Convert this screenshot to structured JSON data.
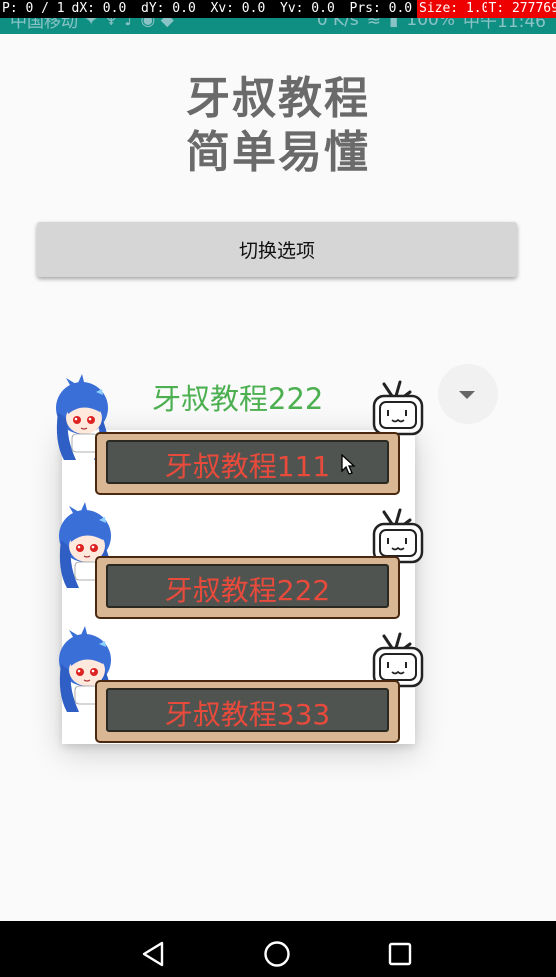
{
  "status_bar": {
    "carrier": "中国移动",
    "speed": "0 K/s",
    "battery": "100%",
    "time": "中午11:46"
  },
  "debug_overlay": {
    "p": "P: 0 / 1",
    "dx": "dX: 0.0",
    "dy": "dY: 0.0",
    "xv": "Xv: 0.0",
    "yv": "Yv: 0.0",
    "prs": "Prs: 0.0",
    "size": "Size: 1.0",
    "t": "T: 277769"
  },
  "title": {
    "line1": "牙叔教程",
    "line2": "简单易懂"
  },
  "switch_button": {
    "label": "切换选项"
  },
  "spinner": {
    "selected": "牙叔教程222"
  },
  "dropdown": {
    "items": [
      {
        "label": "牙叔教程111"
      },
      {
        "label": "牙叔教程222"
      },
      {
        "label": "牙叔教程333"
      }
    ]
  },
  "colors": {
    "status_bar": "#0f8f82",
    "spinner_text": "#4caf50",
    "item_text": "#e84a3c",
    "board_frame": "#d9b795",
    "board_inner": "#4f5450"
  },
  "icons": [
    "back-icon",
    "home-icon",
    "recents-icon",
    "dropdown-arrow-icon",
    "cursor-icon"
  ]
}
